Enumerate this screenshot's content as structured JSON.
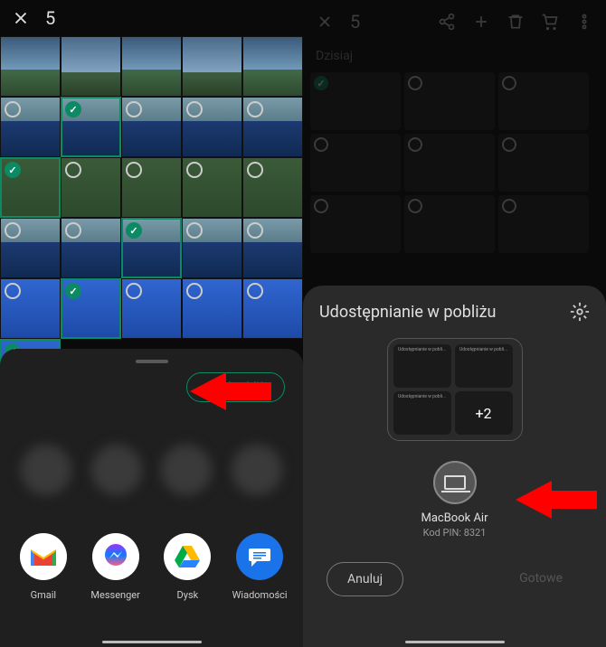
{
  "left": {
    "count": "5",
    "nearby_chip": "W pobliżu",
    "apps": {
      "gmail": "Gmail",
      "messenger": "Messenger",
      "dysk": "Dysk",
      "wiadomosci": "Wiadomości"
    }
  },
  "right": {
    "count": "5",
    "section": "Dzisiaj",
    "panel_title": "Udostępnianie w pobliżu",
    "more_count": "+2",
    "device": {
      "name": "MacBook Air",
      "pin": "Kod PIN: 8321"
    },
    "cancel": "Anuluj",
    "done": "Gotowe"
  }
}
